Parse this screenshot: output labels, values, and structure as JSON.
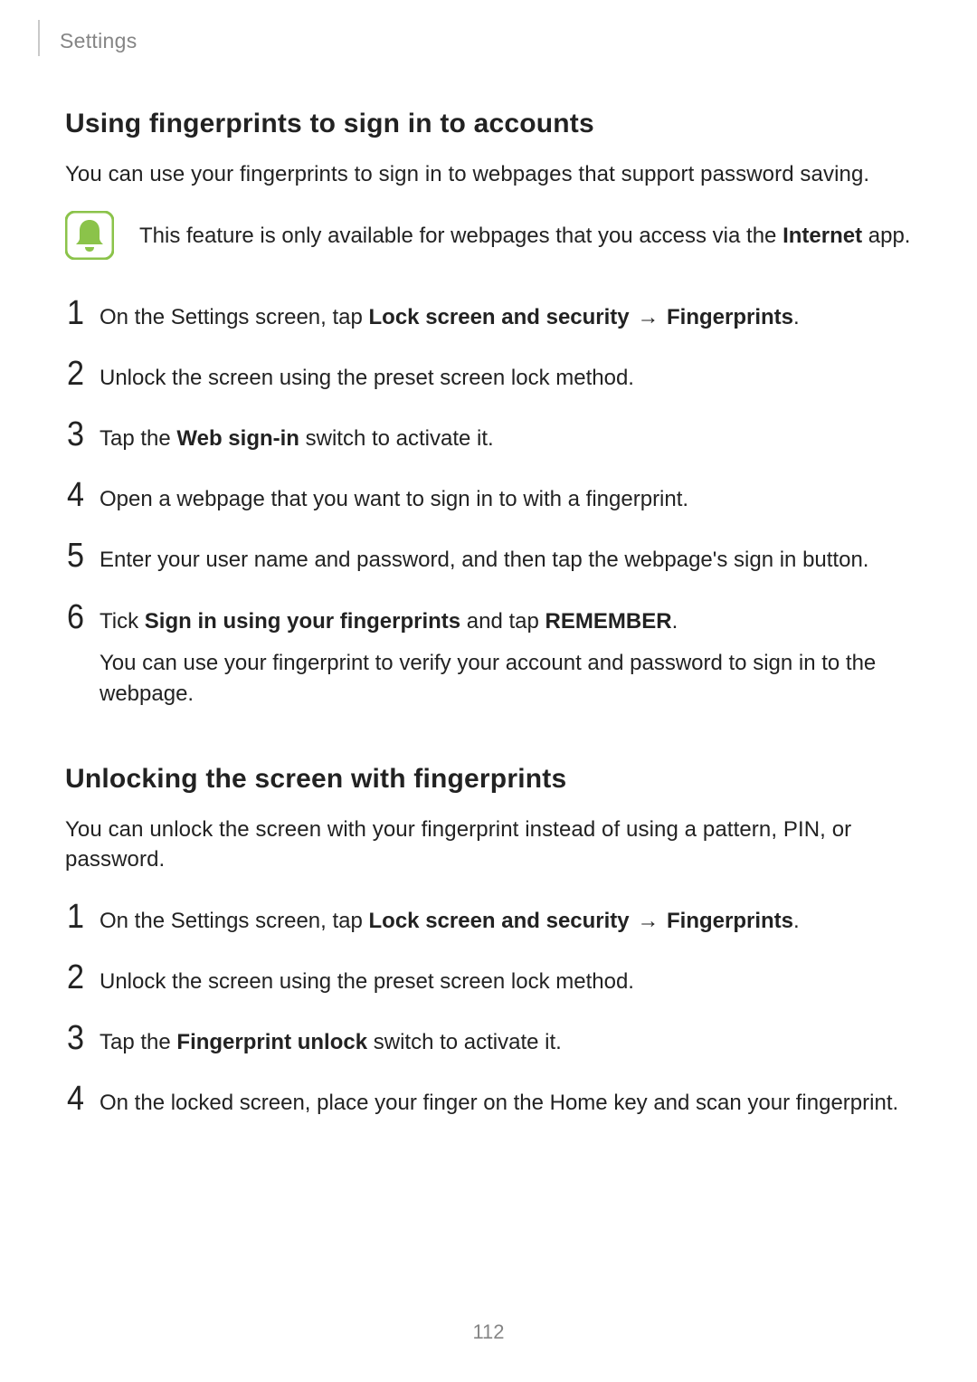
{
  "header": {
    "breadcrumb": "Settings"
  },
  "section1": {
    "title": "Using fingerprints to sign in to accounts",
    "intro": "You can use your fingerprints to sign in to webpages that support password saving.",
    "note_prefix": "This feature is only available for webpages that you access via the ",
    "note_bold": "Internet",
    "note_suffix": " app.",
    "steps": {
      "s1": {
        "num": "1",
        "t1": "On the Settings screen, tap ",
        "b1": "Lock screen and security",
        "arrow": " → ",
        "b2": "Fingerprints",
        "t2": "."
      },
      "s2": {
        "num": "2",
        "text": "Unlock the screen using the preset screen lock method."
      },
      "s3": {
        "num": "3",
        "t1": "Tap the ",
        "b1": "Web sign-in",
        "t2": " switch to activate it."
      },
      "s4": {
        "num": "4",
        "text": "Open a webpage that you want to sign in to with a fingerprint."
      },
      "s5": {
        "num": "5",
        "text": "Enter your user name and password, and then tap the webpage's sign in button."
      },
      "s6": {
        "num": "6",
        "t1": "Tick ",
        "b1": "Sign in using your fingerprints",
        "t2": " and tap ",
        "b2": "REMEMBER",
        "t3": ".",
        "sub": "You can use your fingerprint to verify your account and password to sign in to the webpage."
      }
    }
  },
  "section2": {
    "title": "Unlocking the screen with fingerprints",
    "intro": "You can unlock the screen with your fingerprint instead of using a pattern, PIN, or password.",
    "steps": {
      "s1": {
        "num": "1",
        "t1": "On the Settings screen, tap ",
        "b1": "Lock screen and security",
        "arrow": " → ",
        "b2": "Fingerprints",
        "t2": "."
      },
      "s2": {
        "num": "2",
        "text": "Unlock the screen using the preset screen lock method."
      },
      "s3": {
        "num": "3",
        "t1": "Tap the ",
        "b1": "Fingerprint unlock",
        "t2": " switch to activate it."
      },
      "s4": {
        "num": "4",
        "text": "On the locked screen, place your finger on the Home key and scan your fingerprint."
      }
    }
  },
  "page_number": "112"
}
